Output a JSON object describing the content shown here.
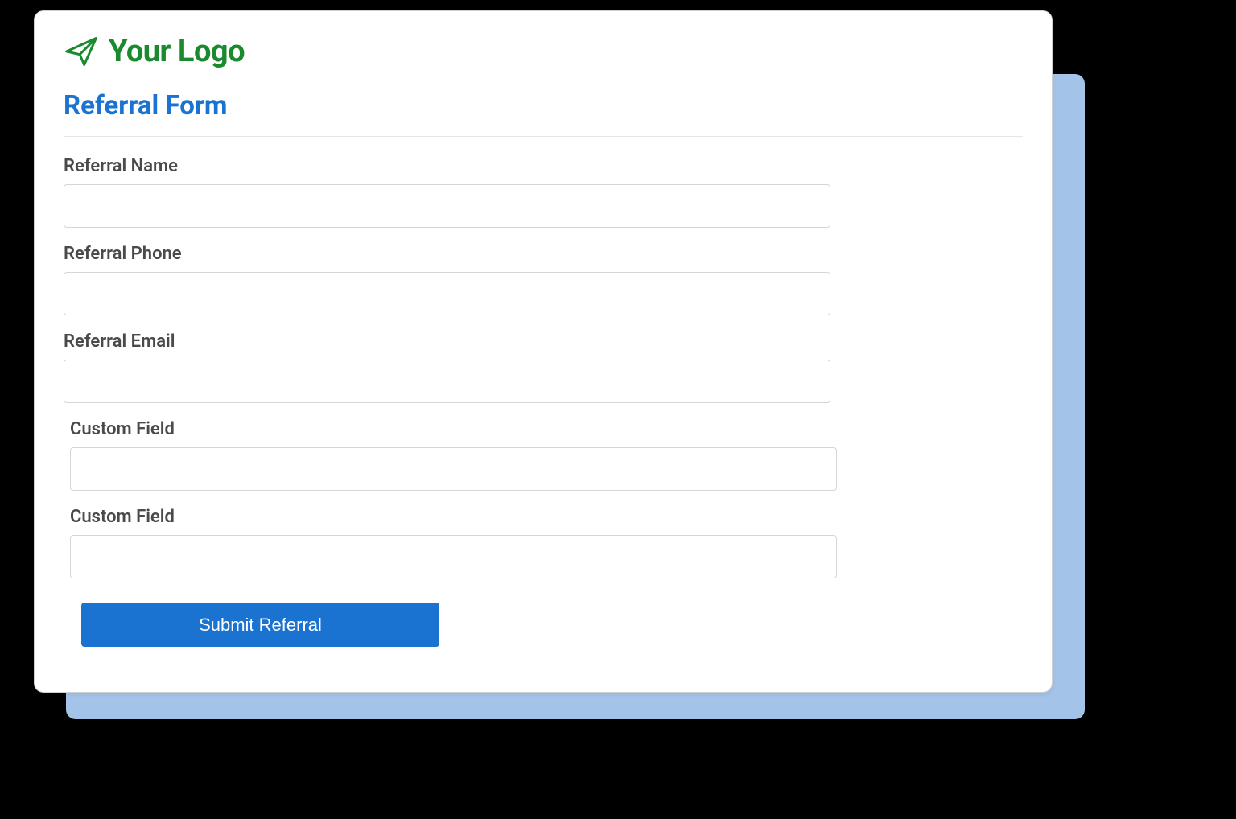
{
  "logo": {
    "text": "Your Logo"
  },
  "form": {
    "heading": "Referral Form",
    "fields": [
      {
        "label": "Referral Name",
        "value": ""
      },
      {
        "label": "Referral Phone",
        "value": ""
      },
      {
        "label": "Referral Email",
        "value": ""
      },
      {
        "label": "Custom Field",
        "value": ""
      },
      {
        "label": "Custom Field",
        "value": ""
      }
    ],
    "submit_label": "Submit Referral"
  },
  "colors": {
    "logo_green": "#1B8A2E",
    "heading_blue": "#1A73D1",
    "shadow_blue": "#A3C3E9",
    "label_gray": "#4a4a4a"
  }
}
